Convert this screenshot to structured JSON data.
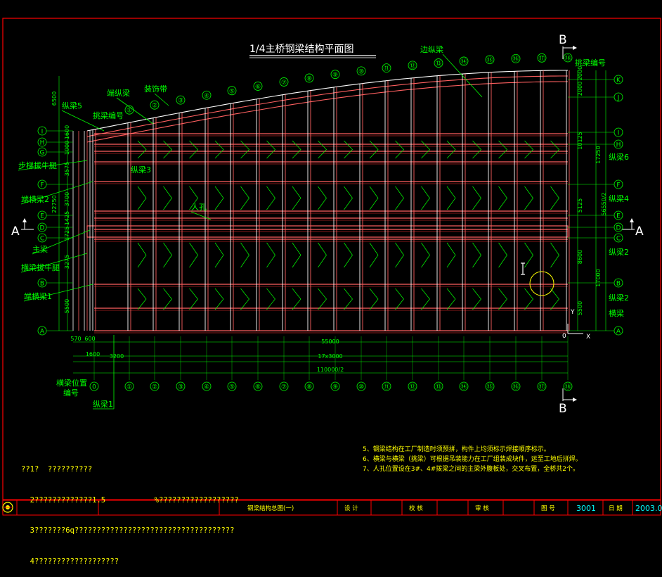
{
  "drawing": {
    "title": "1/4主桥钢梁结构平面图",
    "section_markers": {
      "a": "A",
      "b": "B"
    },
    "axis": {
      "x": "X",
      "y": "Y",
      "origin": "0"
    }
  },
  "grid_top_labels": [
    "①",
    "②",
    "③",
    "④",
    "⑤",
    "⑥",
    "⑦",
    "⑧",
    "⑨",
    "⑩",
    "⑪",
    "⑫",
    "⑬",
    "⑭",
    "⑮",
    "⑯",
    "⑰",
    "⑱"
  ],
  "grid_bottom_labels": [
    "0",
    "①",
    "②",
    "③",
    "④",
    "⑤",
    "⑥",
    "⑦",
    "⑧",
    "⑨",
    "⑩",
    "⑪",
    "⑫",
    "⑬",
    "⑭",
    "⑮",
    "⑯",
    "⑰",
    "⑱"
  ],
  "row_labels_left": [
    "I",
    "H",
    "G",
    "F",
    "E",
    "D",
    "C",
    "B",
    "A"
  ],
  "row_labels_right": [
    "K",
    "J",
    "I",
    "H",
    "F",
    "E",
    "D",
    "C",
    "B",
    "A"
  ],
  "callouts_left": [
    "纵梁5",
    "挑梁编号",
    "端纵梁",
    "装饰带",
    "步梯拔牛腿",
    "端横梁2",
    "主梁",
    "横梁拔牛腿",
    "端横梁1",
    "横梁位置",
    "编号",
    "纵梁1",
    "纵梁3",
    "人孔"
  ],
  "callouts_right": [
    "边纵梁",
    "挑梁编号",
    "纵梁6",
    "纵梁4",
    "纵梁2",
    "纵梁2",
    "横梁"
  ],
  "dims_left": [
    "6500",
    "1600",
    "1000",
    "3575",
    "3700",
    "1425",
    "1725",
    "22750",
    "3275",
    "5500"
  ],
  "dims_right": [
    "2000",
    "2000",
    "10125",
    "17250",
    "5125",
    "56550/2",
    "8600",
    "17000",
    "5500"
  ],
  "dims_bottom": [
    "570",
    "600",
    "1600",
    "3200",
    "55000",
    "17x3000",
    "110000/2"
  ],
  "notes_left": [
    "??1?  ??????????",
    "  2?????????????1.5           %??????????????????",
    "  3???????6q????????????????????????????????????",
    "  4???????????????????"
  ],
  "notes_right": [
    "5、钢梁结构在工厂制造时须预拼，构件上均须标示焊接顺序标示。",
    "6、横梁与横梁（挑梁）可根据吊装能力在工厂组装成块件，运至工地后拼焊。",
    "7、人孔位置设在3#、4#拨梁之间的主梁外腹板处，交叉布置，全桥共2个。"
  ],
  "title_block": {
    "drawing_name": "钢梁结构总图(一)",
    "design_label": "设 计",
    "check_label": "校 核",
    "review_label": "审 核",
    "drawing_no_label": "图 号",
    "drawing_no": "3001",
    "date_label": "日 期",
    "date": "2003.0"
  },
  "colors": {
    "background": "#000000",
    "frame": "#ff0000",
    "annotation": "#00ff00",
    "members": "#ff6060",
    "white": "#ffffff",
    "notes": "#ffff00",
    "title_block_text": "#ffff00",
    "accent_yellow": "#ffff00",
    "cyan": "#00ffff"
  }
}
